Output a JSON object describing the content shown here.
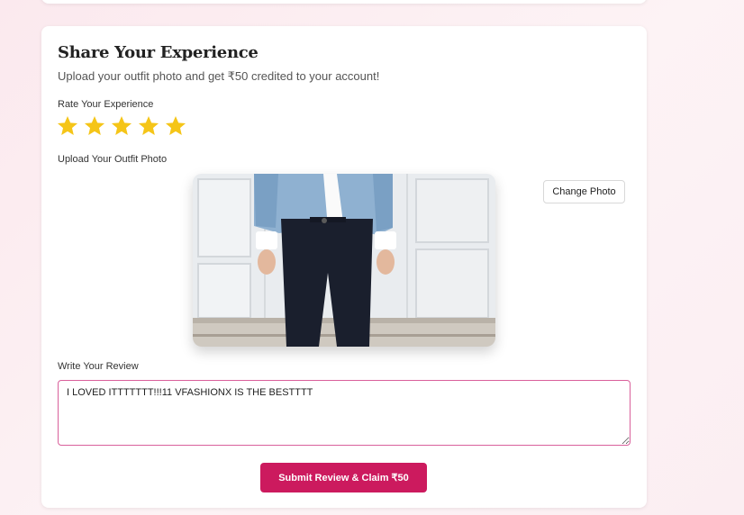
{
  "review_card": {
    "title": "Share Your Experience",
    "subtitle": "Upload your outfit photo and get ₹50 credited to your account!",
    "rating_label": "Rate Your Experience",
    "rating": 5,
    "rating_max": 5,
    "star_color": "#F5C518",
    "upload_label": "Upload Your Outfit Photo",
    "change_photo_label": "Change Photo",
    "review_label": "Write Your Review",
    "review_text": "I LOVED ITTTTTTT!!!11 VFASHIONX IS THE BESTTTT",
    "submit_label": "Submit Review & Claim ₹50",
    "accent_color": "#CC1A5E"
  }
}
